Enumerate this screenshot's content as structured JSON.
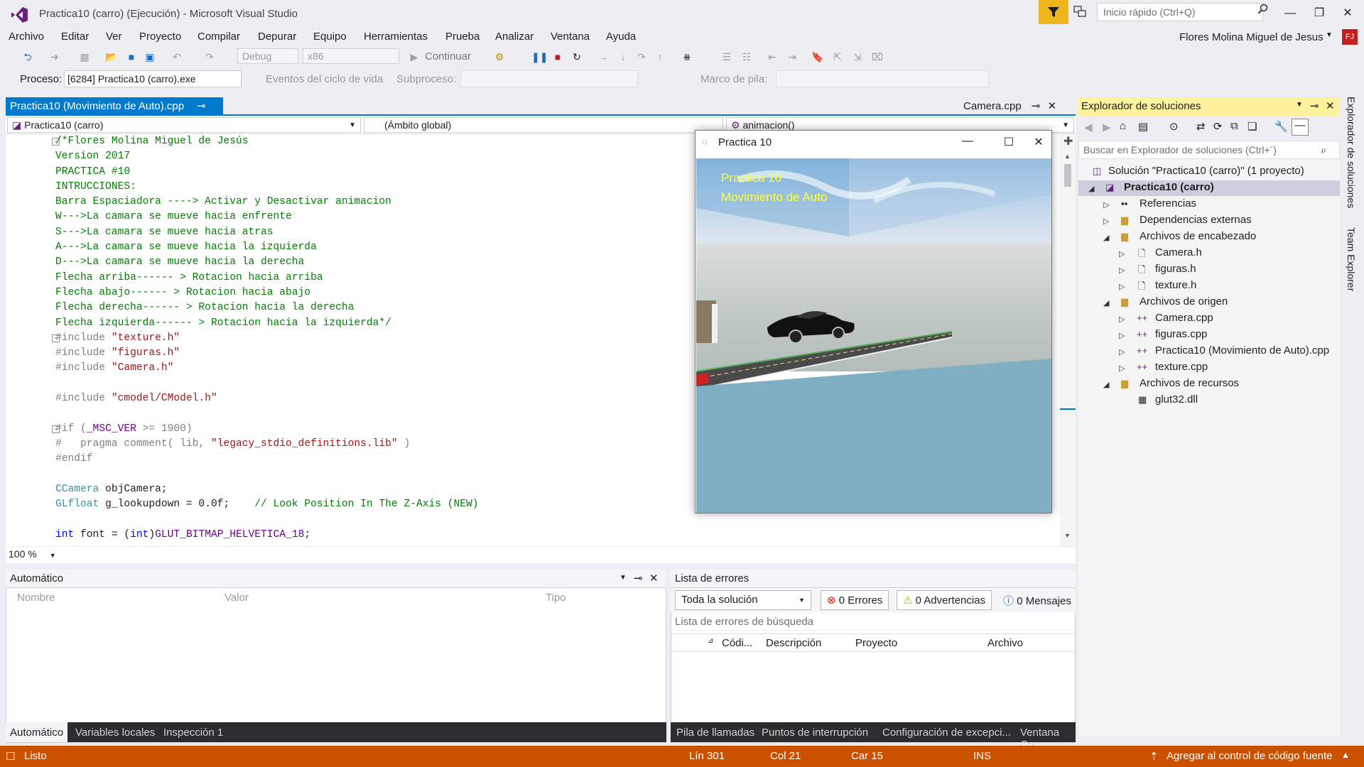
{
  "window": {
    "title": "Practica10 (carro) (Ejecución) - Microsoft Visual Studio",
    "quick_launch_placeholder": "Inicio rápido (Ctrl+Q)",
    "user": "Flores Molina Miguel de Jesus",
    "avatar": "FJ"
  },
  "menu": [
    "Archivo",
    "Editar",
    "Ver",
    "Proyecto",
    "Compilar",
    "Depurar",
    "Equipo",
    "Herramientas",
    "Prueba",
    "Analizar",
    "Ventana",
    "Ayuda"
  ],
  "toolbar": {
    "config": "Debug",
    "platform": "x86",
    "continue": "Continuar"
  },
  "debug_bar": {
    "process_label": "Proceso:",
    "process": "[6284] Practica10 (carro).exe",
    "events": "Eventos del ciclo de vida",
    "thread_label": "Subproceso:",
    "stack_label": "Marco de pila:"
  },
  "editor": {
    "tab": "Practica10 (Movimiento de Auto).cpp",
    "tab2": "Camera.cpp",
    "nav_project": "Practica10 (carro)",
    "nav_scope": "(Ámbito global)",
    "nav_function": "animacion()",
    "zoom": "100 %",
    "lines": [
      [
        [
          "c-cm",
          "/*Flores Molina Miguel de Jesús"
        ]
      ],
      [
        [
          "c-cm",
          "Version 2017"
        ]
      ],
      [
        [
          "c-cm",
          "PRACTICA #10"
        ]
      ],
      [
        [
          "c-cm",
          "INTRUCCIONES:"
        ]
      ],
      [
        [
          "c-cm",
          "Barra Espaciadora ----> Activar y Desactivar animacion"
        ]
      ],
      [
        [
          "c-cm",
          "W--->La camara se mueve hacia enfrente"
        ]
      ],
      [
        [
          "c-cm",
          "S--->La camara se mueve hacia atras"
        ]
      ],
      [
        [
          "c-cm",
          "A--->La camara se mueve hacia la izquierda"
        ]
      ],
      [
        [
          "c-cm",
          "D--->La camara se mueve hacia la derecha"
        ]
      ],
      [
        [
          "c-cm",
          "Flecha arriba------ > Rotacion hacia arriba"
        ]
      ],
      [
        [
          "c-cm",
          "Flecha abajo------ > Rotacion hacia abajo"
        ]
      ],
      [
        [
          "c-cm",
          "Flecha derecha------ > Rotacion hacia la derecha"
        ]
      ],
      [
        [
          "c-cm",
          "Flecha izquierda------ > Rotacion hacia la izquierda*/"
        ]
      ],
      [
        [
          "c-pp",
          "#include "
        ],
        [
          "c-st",
          "\"texture.h\""
        ]
      ],
      [
        [
          "c-pp",
          "#include "
        ],
        [
          "c-st",
          "\"figuras.h\""
        ]
      ],
      [
        [
          "c-pp",
          "#include "
        ],
        [
          "c-st",
          "\"Camera.h\""
        ]
      ],
      [
        [
          "c-df",
          ""
        ]
      ],
      [
        [
          "c-pp",
          "#include "
        ],
        [
          "c-st",
          "\"cmodel/CModel.h\""
        ]
      ],
      [
        [
          "c-df",
          ""
        ]
      ],
      [
        [
          "c-pp",
          "#if ("
        ],
        [
          "c-mc",
          "_MSC_VER"
        ],
        [
          "c-pp",
          " >= 1900)"
        ]
      ],
      [
        [
          "c-pp",
          "#   pragma comment( lib, "
        ],
        [
          "c-st",
          "\"legacy_stdio_definitions.lib\""
        ],
        [
          "c-pp",
          " )"
        ]
      ],
      [
        [
          "c-pp",
          "#endif"
        ]
      ],
      [
        [
          "c-df",
          ""
        ]
      ],
      [
        [
          "c-ty",
          "CCamera"
        ],
        [
          "c-df",
          " objCamera;"
        ]
      ],
      [
        [
          "c-ty",
          "GLfloat"
        ],
        [
          "c-df",
          " g_lookupdown = 0.0f;    "
        ],
        [
          "c-cm",
          "// Look Position In The Z-Axis (NEW)"
        ]
      ],
      [
        [
          "c-df",
          ""
        ]
      ],
      [
        [
          "c-kw",
          "int"
        ],
        [
          "c-df",
          " font = ("
        ],
        [
          "c-kw",
          "int"
        ],
        [
          "c-df",
          ")"
        ],
        [
          "c-mc",
          "GLUT_BITMAP_HELVETICA_18"
        ],
        [
          "c-df",
          ";"
        ]
      ]
    ]
  },
  "app_window": {
    "title": "Practica 10",
    "hud_line1": "Practica 10",
    "hud_line2": "Movimiento de Auto"
  },
  "solution_explorer": {
    "title": "Explorador de soluciones",
    "search_placeholder": "Buscar en Explorador de soluciones (Ctrl+´)",
    "items": [
      {
        "label": "Solución \"Practica10 (carro)\" (1 proyecto)",
        "icon": "solution-icon"
      },
      {
        "label": "Practica10 (carro)",
        "icon": "project-icon"
      },
      {
        "label": "Referencias",
        "icon": "references-icon"
      },
      {
        "label": "Dependencias externas",
        "icon": "folder-icon"
      },
      {
        "label": "Archivos de encabezado",
        "icon": "folder-icon"
      },
      {
        "label": "Camera.h",
        "icon": "header-file-icon"
      },
      {
        "label": "figuras.h",
        "icon": "header-file-icon"
      },
      {
        "label": "texture.h",
        "icon": "header-file-icon"
      },
      {
        "label": "Archivos de origen",
        "icon": "folder-icon"
      },
      {
        "label": "Camera.cpp",
        "icon": "cpp-file-icon"
      },
      {
        "label": "figuras.cpp",
        "icon": "cpp-file-icon"
      },
      {
        "label": "Practica10 (Movimiento de Auto).cpp",
        "icon": "cpp-file-icon"
      },
      {
        "label": "texture.cpp",
        "icon": "cpp-file-icon"
      },
      {
        "label": "Archivos de recursos",
        "icon": "folder-icon"
      },
      {
        "label": "glut32.dll",
        "icon": "dll-file-icon"
      }
    ]
  },
  "side_tabs": {
    "tab1": "Explorador de soluciones",
    "tab2": "Team Explorer"
  },
  "autos_panel": {
    "title": "Automático",
    "columns": [
      "Nombre",
      "Valor",
      "Tipo"
    ],
    "tabs": [
      "Automático",
      "Variables locales",
      "Inspección 1"
    ]
  },
  "errors_panel": {
    "title": "Lista de errores",
    "scope": "Toda la solución",
    "errors": "0 Errores",
    "warnings": "0 Advertencias",
    "messages": "0 Mensajes",
    "search_placeholder": "Lista de errores de búsqueda",
    "columns": [
      "Códi...",
      "Descripción",
      "Proyecto",
      "Archivo"
    ],
    "tabs": [
      "Pila de llamadas",
      "Puntos de interrupción",
      "Configuración de excepci...",
      "Ventana Co"
    ]
  },
  "status_bar": {
    "state": "Listo",
    "line": "Lín 301",
    "col": "Col 21",
    "char": "Car 15",
    "mode": "INS",
    "source_control": "Agregar al control de código fuente"
  },
  "colors": {
    "accent": "#007acc",
    "status_bar": "#ca5100",
    "se_header": "#fff29d",
    "hud_text": "#ffff40"
  }
}
